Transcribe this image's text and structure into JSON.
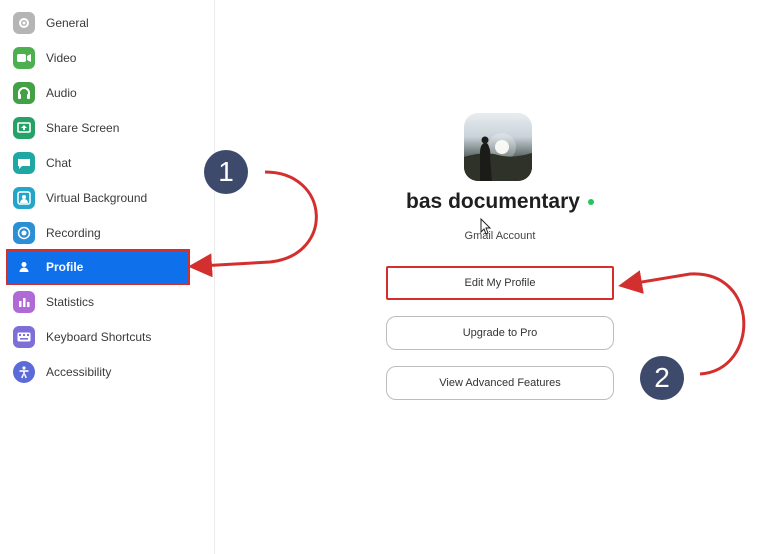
{
  "sidebar": {
    "items": [
      {
        "label": "General",
        "icon": "gear-icon",
        "color": "#a8a8a8"
      },
      {
        "label": "Video",
        "icon": "video-camera-icon",
        "color": "#4caf50"
      },
      {
        "label": "Audio",
        "icon": "headphones-icon",
        "color": "#43a047"
      },
      {
        "label": "Share Screen",
        "icon": "share-screen-icon",
        "color": "#26a269"
      },
      {
        "label": "Chat",
        "icon": "chat-bubble-icon",
        "color": "#1ea7a3"
      },
      {
        "label": "Virtual Background",
        "icon": "person-frame-icon",
        "color": "#23a6c8"
      },
      {
        "label": "Recording",
        "icon": "record-icon",
        "color": "#2b8fd6"
      },
      {
        "label": "Profile",
        "icon": "person-icon",
        "color": "#0e71eb",
        "active": true
      },
      {
        "label": "Statistics",
        "icon": "bar-chart-icon",
        "color": "#b06ad6"
      },
      {
        "label": "Keyboard Shortcuts",
        "icon": "keyboard-icon",
        "color": "#7e6fd8"
      },
      {
        "label": "Accessibility",
        "icon": "accessibility-icon",
        "color": "#5b6bd8"
      }
    ]
  },
  "profile": {
    "display_name": "bas documentary",
    "account_type": "Gmail Account",
    "status_color": "#23c55e"
  },
  "buttons": {
    "edit_profile": "Edit My Profile",
    "upgrade": "Upgrade to Pro",
    "advanced": "View Advanced Features"
  },
  "callouts": {
    "one": "1",
    "two": "2"
  },
  "colors": {
    "accent": "#0e71eb",
    "highlight": "#d32f2f",
    "callout_bg": "#3d4a6b"
  }
}
